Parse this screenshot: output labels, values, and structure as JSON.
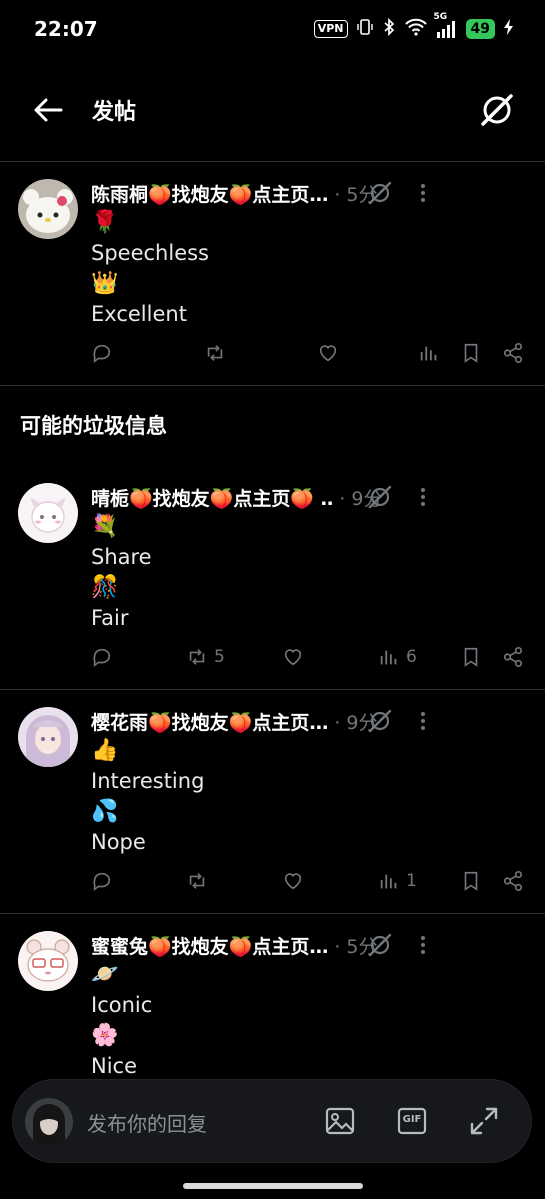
{
  "status_bar": {
    "time": "22:07",
    "vpn": "VPN",
    "network": "5G",
    "battery": "49"
  },
  "header": {
    "title": "发帖",
    "back_icon": "arrow-left-icon",
    "grok_icon": "grok-icon"
  },
  "section_title": "可能的垃圾信息",
  "posts": [
    {
      "author": "陈雨桐🍑找炮友🍑点主页…",
      "time": "· 5分",
      "lines": [
        "🌹",
        "Speechless",
        "👑",
        "Excellent"
      ],
      "replies": "",
      "reposts": "",
      "likes": "",
      "views": ""
    },
    {
      "author": "晴栀🍑找炮友🍑点主页🍑 ‥",
      "time": "· 9分",
      "lines": [
        "💐",
        "Share",
        "🎊",
        "Fair"
      ],
      "replies": "",
      "reposts": "5",
      "likes": "",
      "views": "6"
    },
    {
      "author": "樱花雨🍑找炮友🍑点主页…",
      "time": "· 9分",
      "lines": [
        "👍",
        "Interesting",
        "💦",
        "Nope"
      ],
      "replies": "",
      "reposts": "",
      "likes": "",
      "views": "1"
    },
    {
      "author": "蜜蜜兔🍑找炮友🍑点主页…",
      "time": "· 5分",
      "lines": [
        "🪐",
        "Iconic",
        "🌸",
        "Nice"
      ],
      "replies": "",
      "reposts": "",
      "likes": "",
      "views": ""
    }
  ],
  "reply_bar": {
    "placeholder": "发布你的回复",
    "gif_label": "GIF"
  },
  "colors": {
    "background": "#000000",
    "text": "#e7e9ea",
    "muted": "#71767b",
    "divider": "#2f3336",
    "battery": "#34c759"
  }
}
